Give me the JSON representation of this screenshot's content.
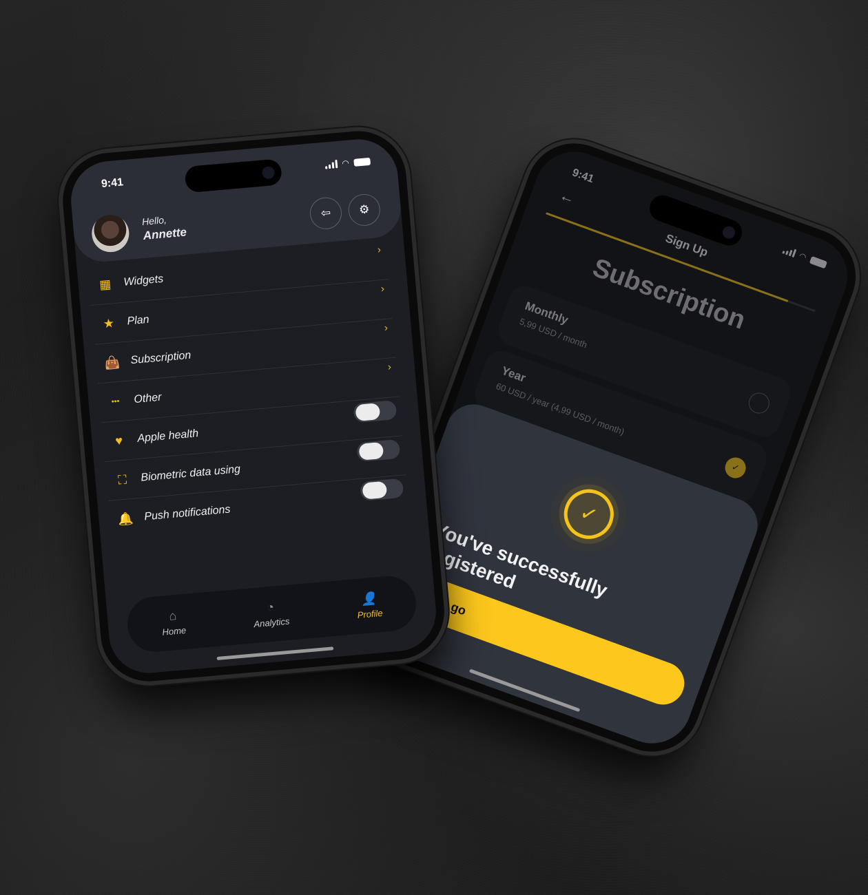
{
  "left_phone": {
    "status": {
      "time": "9:41"
    },
    "header": {
      "greeting": "Hello,",
      "user_name": "Annette",
      "logout_icon": "logout-icon",
      "settings_icon": "gear-icon"
    },
    "menu": [
      {
        "label": "Widgets",
        "icon": "grid-icon",
        "glyph": "▦",
        "type": "link"
      },
      {
        "label": "Plan",
        "icon": "star-icon",
        "glyph": "★",
        "type": "link"
      },
      {
        "label": "Subscription",
        "icon": "shopping-bag-icon",
        "glyph": "👜",
        "type": "link"
      },
      {
        "label": "Other",
        "icon": "more-dots-icon",
        "glyph": "•••",
        "type": "link"
      }
    ],
    "toggles": [
      {
        "label": "Apple health",
        "icon": "heart-icon",
        "glyph": "♥",
        "on": false
      },
      {
        "label": "Biometric data using",
        "icon": "face-scan-icon",
        "glyph": "⛶",
        "on": false
      },
      {
        "label": "Push notifications",
        "icon": "bell-icon",
        "glyph": "🔔",
        "on": false
      }
    ],
    "chevron": "›",
    "tabs": [
      {
        "label": "Home",
        "icon": "home-icon",
        "glyph": "⌂",
        "active": false
      },
      {
        "label": "Analytics",
        "icon": "pie-chart-icon",
        "glyph": "◔",
        "active": false
      },
      {
        "label": "Profile",
        "icon": "user-icon",
        "glyph": "👤",
        "active": true
      }
    ]
  },
  "right_phone": {
    "status": {
      "time": "9:41"
    },
    "back_glyph": "←",
    "title": "Sign Up",
    "progress": 0.9,
    "heading": "Subscription",
    "plans": [
      {
        "name": "Monthly",
        "price": "5,99 USD / month",
        "selected": false
      },
      {
        "name": "Year",
        "price": "60 USD / year (4,99 USD / month)",
        "selected": true
      }
    ],
    "success_message": "You've successfully registered",
    "cta_label": "Let's go",
    "check_glyph": "✓"
  },
  "colors": {
    "accent": "#fdc81c",
    "background_dark": "#1c1e23",
    "card": "#2b2e36"
  }
}
